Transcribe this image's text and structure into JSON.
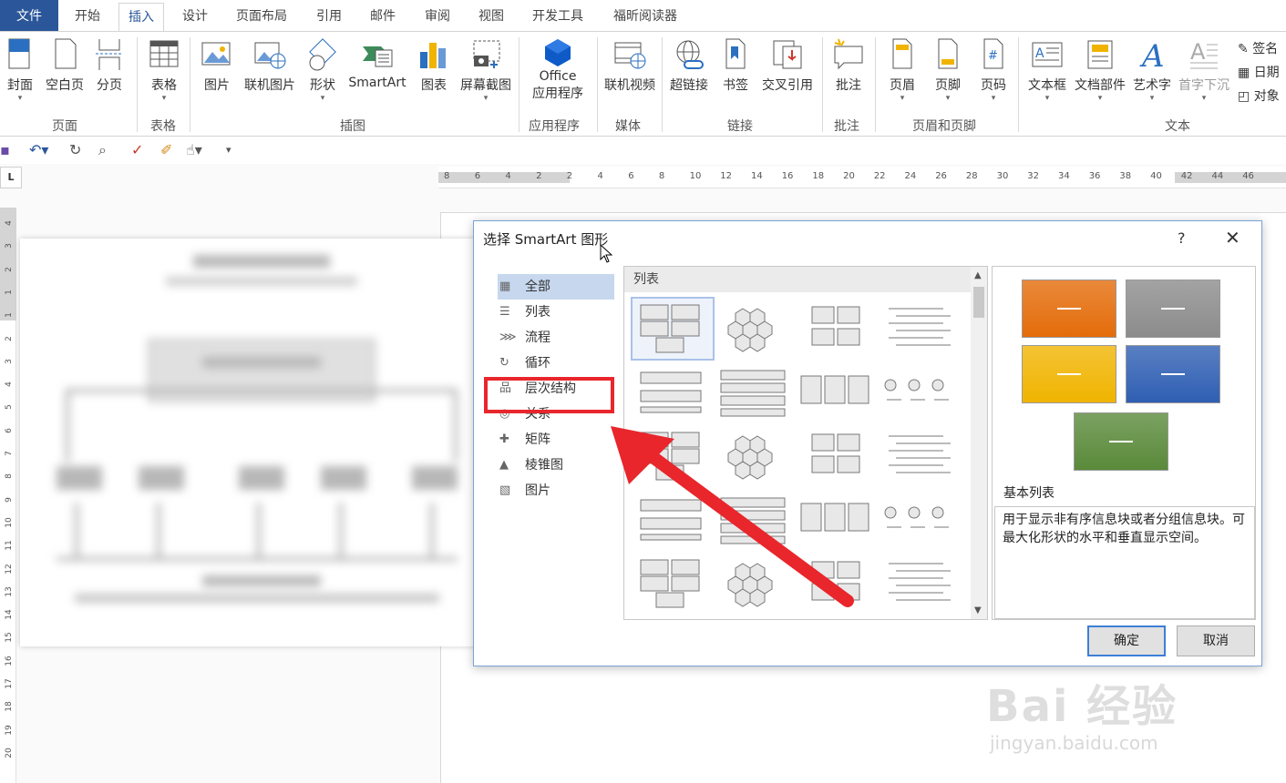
{
  "tabs": {
    "file": "文件",
    "home": "开始",
    "insert": "插入",
    "design": "设计",
    "layout": "页面布局",
    "references": "引用",
    "mailings": "邮件",
    "review": "审阅",
    "view": "视图",
    "developer": "开发工具",
    "foxit": "福昕阅读器"
  },
  "ribbon": {
    "cover": "封面",
    "blank": "空白页",
    "pagebreak": "分页",
    "table": "表格",
    "picture": "图片",
    "online_picture": "联机图片",
    "shapes": "形状",
    "smartart": "SmartArt",
    "chart": "图表",
    "screenshot": "屏幕截图",
    "office_line1": "Office",
    "office_line2": "应用程序",
    "online_video": "联机视频",
    "hyperlink": "超链接",
    "bookmark": "书签",
    "crossref": "交叉引用",
    "comment": "批注",
    "header": "页眉",
    "footer": "页脚",
    "pagenum": "页码",
    "textbox": "文本框",
    "quickparts": "文档部件",
    "wordart": "艺术字",
    "dropcap": "首字下沉",
    "signature": "签名",
    "datetime": "日期",
    "object": "对象",
    "groups": {
      "pages": "页面",
      "tables": "表格",
      "illustrations": "插图",
      "apps": "应用程序",
      "media": "媒体",
      "links": "链接",
      "comments": "批注",
      "headerfooter": "页眉和页脚",
      "text": "文本"
    }
  },
  "ruler": {
    "corner": "L",
    "h_numbers": [
      "8",
      "6",
      "4",
      "2",
      "2",
      "4",
      "6",
      "8",
      "10",
      "12",
      "14",
      "16",
      "18",
      "20",
      "22",
      "24",
      "26",
      "28",
      "30",
      "32",
      "34",
      "36",
      "38",
      "40",
      "42",
      "44",
      "46"
    ],
    "v_numbers": [
      "4",
      "3",
      "2",
      "1",
      "1",
      "2",
      "3",
      "4",
      "5",
      "6",
      "7",
      "8",
      "9",
      "10",
      "11",
      "12",
      "13",
      "14",
      "15",
      "16",
      "17",
      "18",
      "19",
      "20"
    ]
  },
  "dialog": {
    "title": "选择 SmartArt 图形",
    "help": "?",
    "categories": [
      "全部",
      "列表",
      "流程",
      "循环",
      "层次结构",
      "关系",
      "矩阵",
      "棱锥图",
      "图片"
    ],
    "gallery_header": "列表",
    "preview_title": "基本列表",
    "preview_desc": "用于显示非有序信息块或者分组信息块。可最大化形状的水平和垂直显示空间。",
    "ok": "确定",
    "cancel": "取消",
    "swatch_colors": [
      "#e46c0a",
      "#8c8c8c",
      "#f0b400",
      "#2f5fb3",
      "#5a8a3a"
    ]
  },
  "watermark": {
    "line1": "Bai 经验",
    "line2": "jingyan.baidu.com"
  }
}
